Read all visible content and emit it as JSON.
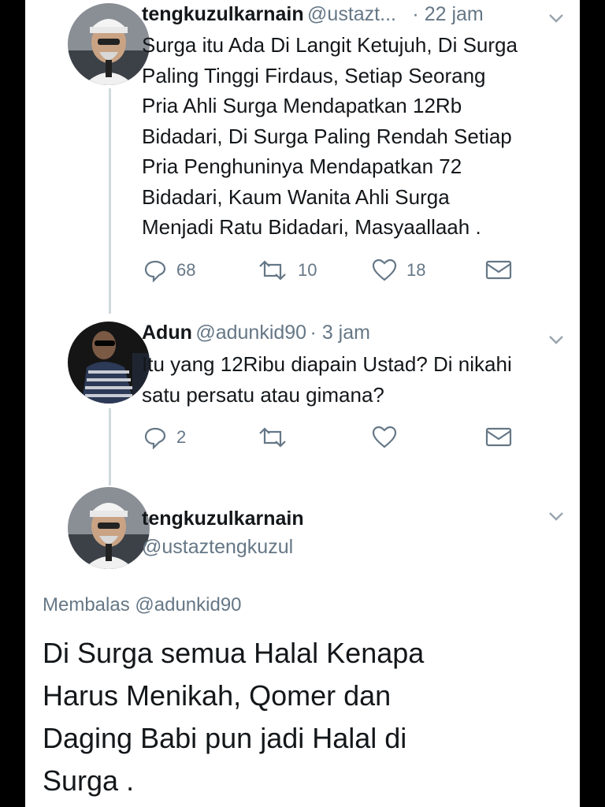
{
  "tweets": [
    {
      "name": "tengkuzulkarnain",
      "handle": "@ustazt...",
      "time": "· 22 jam",
      "lines": [
        "Surga itu Ada Di Langit Ketujuh, Di Surga",
        "Paling Tinggi Firdaus, Setiap Seorang",
        "Pria Ahli Surga Mendapatkan 12Rb",
        "Bidadari, Di Surga Paling Rendah Setiap",
        "Pria Penghuninya Mendapatkan 72",
        "Bidadari, Kaum Wanita Ahli Surga",
        "Menjadi Ratu Bidadari, Masyaallaah ."
      ],
      "replies": "68",
      "retweets": "10",
      "likes": "18"
    },
    {
      "name": "Adun",
      "handle": "@adunkid90",
      "time": "· 3 jam",
      "lines": [
        "Itu yang 12Ribu diapain Ustad? Di nikahi",
        "satu persatu atau gimana?"
      ],
      "replies": "2",
      "retweets": "",
      "likes": ""
    }
  ],
  "main_tweet": {
    "name": "tengkuzulkarnain",
    "handle": "@ustaztengkuzul",
    "replying_label": "Membalas",
    "replying_to": "@adunkid90",
    "lines": [
      "Di Surga semua Halal Kenapa",
      "Harus Menikah, Qomer dan",
      "Daging Babi pun jadi Halal di",
      "Surga ."
    ]
  },
  "icons": {
    "reply": "reply-icon",
    "retweet": "retweet-icon",
    "like": "heart-icon",
    "dm": "envelope-icon",
    "more": "chevron-down-icon"
  },
  "colors": {
    "text": "#14171a",
    "secondary": "#657786",
    "thread_line": "#cfd9de",
    "background": "#ffffff",
    "frame": "#000000"
  }
}
